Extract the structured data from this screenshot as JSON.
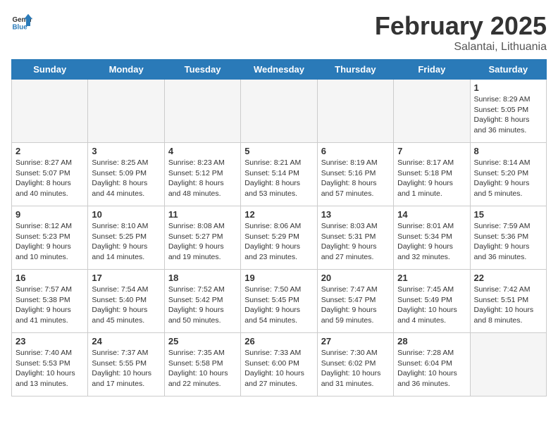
{
  "header": {
    "logo_line1": "General",
    "logo_line2": "Blue",
    "title": "February 2025",
    "subtitle": "Salantai, Lithuania"
  },
  "weekdays": [
    "Sunday",
    "Monday",
    "Tuesday",
    "Wednesday",
    "Thursday",
    "Friday",
    "Saturday"
  ],
  "weeks": [
    [
      {
        "day": "",
        "info": ""
      },
      {
        "day": "",
        "info": ""
      },
      {
        "day": "",
        "info": ""
      },
      {
        "day": "",
        "info": ""
      },
      {
        "day": "",
        "info": ""
      },
      {
        "day": "",
        "info": ""
      },
      {
        "day": "1",
        "info": "Sunrise: 8:29 AM\nSunset: 5:05 PM\nDaylight: 8 hours and 36 minutes."
      }
    ],
    [
      {
        "day": "2",
        "info": "Sunrise: 8:27 AM\nSunset: 5:07 PM\nDaylight: 8 hours and 40 minutes."
      },
      {
        "day": "3",
        "info": "Sunrise: 8:25 AM\nSunset: 5:09 PM\nDaylight: 8 hours and 44 minutes."
      },
      {
        "day": "4",
        "info": "Sunrise: 8:23 AM\nSunset: 5:12 PM\nDaylight: 8 hours and 48 minutes."
      },
      {
        "day": "5",
        "info": "Sunrise: 8:21 AM\nSunset: 5:14 PM\nDaylight: 8 hours and 53 minutes."
      },
      {
        "day": "6",
        "info": "Sunrise: 8:19 AM\nSunset: 5:16 PM\nDaylight: 8 hours and 57 minutes."
      },
      {
        "day": "7",
        "info": "Sunrise: 8:17 AM\nSunset: 5:18 PM\nDaylight: 9 hours and 1 minute."
      },
      {
        "day": "8",
        "info": "Sunrise: 8:14 AM\nSunset: 5:20 PM\nDaylight: 9 hours and 5 minutes."
      }
    ],
    [
      {
        "day": "9",
        "info": "Sunrise: 8:12 AM\nSunset: 5:23 PM\nDaylight: 9 hours and 10 minutes."
      },
      {
        "day": "10",
        "info": "Sunrise: 8:10 AM\nSunset: 5:25 PM\nDaylight: 9 hours and 14 minutes."
      },
      {
        "day": "11",
        "info": "Sunrise: 8:08 AM\nSunset: 5:27 PM\nDaylight: 9 hours and 19 minutes."
      },
      {
        "day": "12",
        "info": "Sunrise: 8:06 AM\nSunset: 5:29 PM\nDaylight: 9 hours and 23 minutes."
      },
      {
        "day": "13",
        "info": "Sunrise: 8:03 AM\nSunset: 5:31 PM\nDaylight: 9 hours and 27 minutes."
      },
      {
        "day": "14",
        "info": "Sunrise: 8:01 AM\nSunset: 5:34 PM\nDaylight: 9 hours and 32 minutes."
      },
      {
        "day": "15",
        "info": "Sunrise: 7:59 AM\nSunset: 5:36 PM\nDaylight: 9 hours and 36 minutes."
      }
    ],
    [
      {
        "day": "16",
        "info": "Sunrise: 7:57 AM\nSunset: 5:38 PM\nDaylight: 9 hours and 41 minutes."
      },
      {
        "day": "17",
        "info": "Sunrise: 7:54 AM\nSunset: 5:40 PM\nDaylight: 9 hours and 45 minutes."
      },
      {
        "day": "18",
        "info": "Sunrise: 7:52 AM\nSunset: 5:42 PM\nDaylight: 9 hours and 50 minutes."
      },
      {
        "day": "19",
        "info": "Sunrise: 7:50 AM\nSunset: 5:45 PM\nDaylight: 9 hours and 54 minutes."
      },
      {
        "day": "20",
        "info": "Sunrise: 7:47 AM\nSunset: 5:47 PM\nDaylight: 9 hours and 59 minutes."
      },
      {
        "day": "21",
        "info": "Sunrise: 7:45 AM\nSunset: 5:49 PM\nDaylight: 10 hours and 4 minutes."
      },
      {
        "day": "22",
        "info": "Sunrise: 7:42 AM\nSunset: 5:51 PM\nDaylight: 10 hours and 8 minutes."
      }
    ],
    [
      {
        "day": "23",
        "info": "Sunrise: 7:40 AM\nSunset: 5:53 PM\nDaylight: 10 hours and 13 minutes."
      },
      {
        "day": "24",
        "info": "Sunrise: 7:37 AM\nSunset: 5:55 PM\nDaylight: 10 hours and 17 minutes."
      },
      {
        "day": "25",
        "info": "Sunrise: 7:35 AM\nSunset: 5:58 PM\nDaylight: 10 hours and 22 minutes."
      },
      {
        "day": "26",
        "info": "Sunrise: 7:33 AM\nSunset: 6:00 PM\nDaylight: 10 hours and 27 minutes."
      },
      {
        "day": "27",
        "info": "Sunrise: 7:30 AM\nSunset: 6:02 PM\nDaylight: 10 hours and 31 minutes."
      },
      {
        "day": "28",
        "info": "Sunrise: 7:28 AM\nSunset: 6:04 PM\nDaylight: 10 hours and 36 minutes."
      },
      {
        "day": "",
        "info": ""
      }
    ]
  ]
}
